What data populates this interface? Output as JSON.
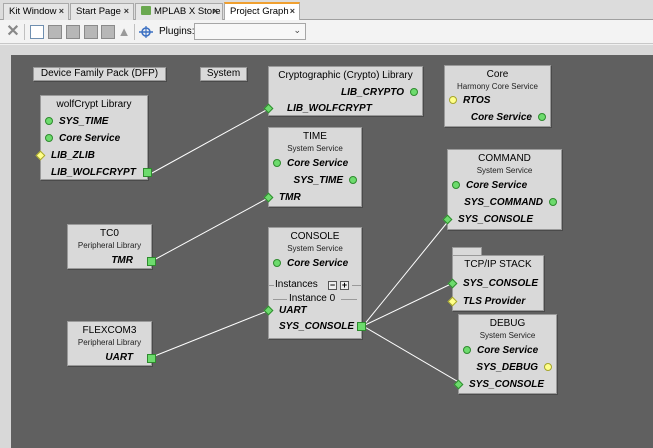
{
  "tabs": [
    {
      "label": "Kit Window",
      "close": "×",
      "active": false
    },
    {
      "label": "Start Page",
      "close": "×",
      "active": false
    },
    {
      "label": "MPLAB X Store",
      "close": "×",
      "active": false
    },
    {
      "label": "Project Graph",
      "close": "×",
      "active": true
    }
  ],
  "toolbar": {
    "plugins_label": "Plugins:",
    "plugins_value": "",
    "dropdown_arrow": "⌄"
  },
  "labels": {
    "dfp": "Device Family Pack (DFP)",
    "system": "System"
  },
  "components": {
    "crypto": {
      "title": "Cryptographic (Crypto) Library",
      "rows": [
        "LIB_CRYPTO",
        "LIB_WOLFCRYPT"
      ]
    },
    "core": {
      "title": "Core",
      "subtitle": "Harmony Core Service",
      "rows": [
        "RTOS",
        "Core Service"
      ]
    },
    "wolfcrypt": {
      "title": "wolfCrypt Library",
      "rows": [
        "SYS_TIME",
        "Core Service",
        "LIB_ZLIB",
        "LIB_WOLFCRYPT"
      ]
    },
    "time": {
      "title": "TIME",
      "subtitle": "System Service",
      "rows": [
        "Core Service",
        "SYS_TIME",
        "TMR"
      ]
    },
    "command": {
      "title": "COMMAND",
      "subtitle": "System Service",
      "rows": [
        "Core Service",
        "SYS_COMMAND",
        "SYS_CONSOLE"
      ]
    },
    "tc0": {
      "title": "TC0",
      "subtitle": "Peripheral Library",
      "rows": [
        "TMR"
      ]
    },
    "console": {
      "title": "CONSOLE",
      "subtitle": "System Service",
      "rows": [
        "Core Service"
      ],
      "instances_label": "Instances",
      "instance_label": "Instance 0",
      "instance_rows": [
        "UART",
        "SYS_CONSOLE"
      ],
      "minus": "−",
      "plus": "+"
    },
    "tcpip": {
      "title": "TCP/IP STACK",
      "rows": [
        "SYS_CONSOLE",
        "TLS Provider"
      ]
    },
    "flexcom3": {
      "title": "FLEXCOM3",
      "subtitle": "Peripheral Library",
      "rows": [
        "UART"
      ]
    },
    "debug": {
      "title": "DEBUG",
      "subtitle": "System Service",
      "rows": [
        "Core Service",
        "SYS_DEBUG",
        "SYS_CONSOLE"
      ]
    }
  },
  "colors": {
    "canvas": "#606060",
    "component_fill": "#d9d9d9",
    "connector_green": "#6ddb6d",
    "connector_yellow": "#ffff8a",
    "wire": "#ffffff",
    "active_tab_accent": "#f0a030"
  }
}
